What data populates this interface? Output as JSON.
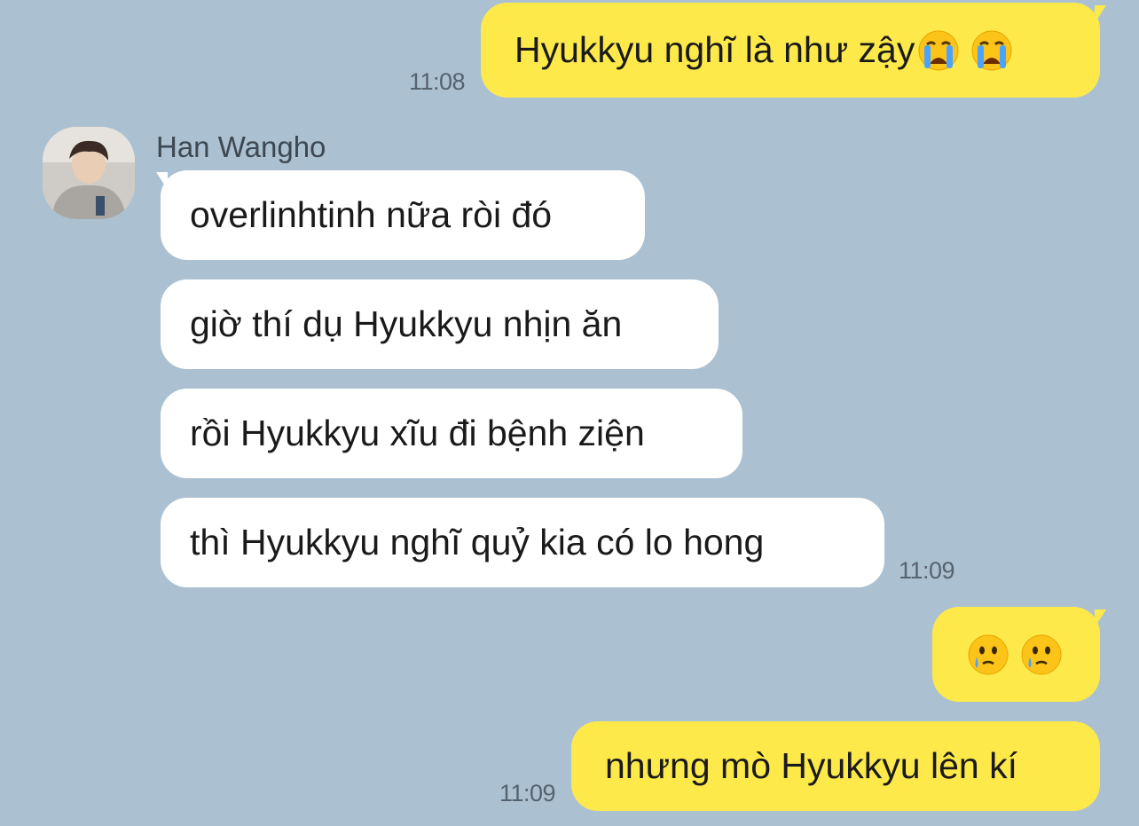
{
  "contact": {
    "name": "Han Wangho"
  },
  "messages": [
    {
      "from": "me",
      "text": "Hyukkyu nghĩ là như zậy",
      "emoji": [
        "loudly-crying-face",
        "loudly-crying-face"
      ],
      "time": "11:08"
    },
    {
      "from": "them",
      "text": "overlinhtinh nữa ròi đó"
    },
    {
      "from": "them",
      "text": "giờ thí dụ Hyukkyu nhịn ăn"
    },
    {
      "from": "them",
      "text": "rồi Hyukkyu xĩu đi bệnh ziện"
    },
    {
      "from": "them",
      "text": "thì Hyukkyu nghĩ quỷ kia có lo hong",
      "time": "11:09"
    },
    {
      "from": "me",
      "text": "",
      "emoji": [
        "face-holding-back-tears",
        "face-holding-back-tears"
      ]
    },
    {
      "from": "me",
      "text": "nhưng mò Hyukkyu lên kí",
      "time": "11:09"
    }
  ],
  "colors": {
    "background": "#abc1d1",
    "my_bubble": "#fee94b",
    "their_bubble": "#ffffff"
  }
}
